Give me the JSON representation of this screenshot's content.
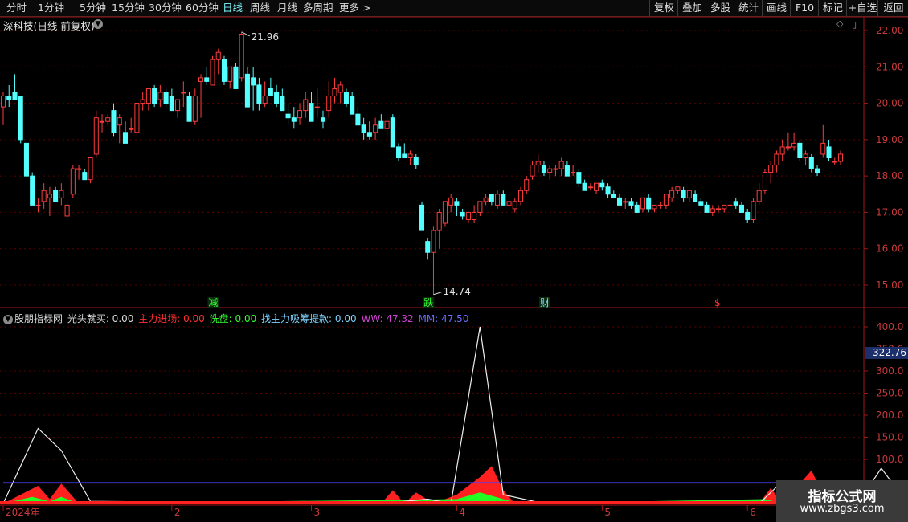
{
  "toolbar": {
    "timeframes": [
      "分时",
      "1分钟",
      "5分钟",
      "15分钟",
      "30分钟",
      "60分钟",
      "日线",
      "周线",
      "月线",
      "多周期",
      "更多 >"
    ],
    "active_timeframe": "日线",
    "right_buttons": [
      "复权",
      "叠加",
      "多股",
      "统计",
      "画线",
      "F10",
      "标记",
      "+自选",
      "返回"
    ]
  },
  "stock_title": "深科技(日线 前复权)",
  "price_axis": {
    "ticks": [
      "22.00",
      "21.00",
      "20.00",
      "19.00",
      "18.00",
      "17.00",
      "16.00",
      "15.00"
    ]
  },
  "price_annotations": {
    "high_label": "21.96",
    "low_label": "14.74"
  },
  "event_markers": [
    {
      "text": "减",
      "color": "#33ff33"
    },
    {
      "text": "跌",
      "color": "#33ff33"
    },
    {
      "text": "财",
      "color": "#7fd4ff"
    },
    {
      "text": "$",
      "color": "#ff3030"
    }
  ],
  "indicator": {
    "name": "股朋指标网",
    "items": [
      {
        "label": "光头就买:",
        "value": "0.00",
        "color": "#d8d8d8"
      },
      {
        "label": "主力进场:",
        "value": "0.00",
        "color": "#ff3030"
      },
      {
        "label": "洗盘:",
        "value": "0.00",
        "color": "#33ff33"
      },
      {
        "label": "找主力吸筹提款:",
        "value": "0.00",
        "color": "#7fd4ff"
      },
      {
        "label": "WW:",
        "value": "47.32",
        "color": "#d040d0"
      },
      {
        "label": "MM:",
        "value": "47.50",
        "color": "#6b6bff"
      }
    ],
    "axis_ticks": [
      "400.0",
      "350.0",
      "300.0",
      "250.0",
      "200.0",
      "150.0",
      "100.0"
    ],
    "current_value": "322.76"
  },
  "date_labels": [
    "2024年",
    "2",
    "3",
    "4",
    "5",
    "6"
  ],
  "watermark": {
    "line1": "指标公式网",
    "line2": "www.zbgs3.com"
  },
  "colors": {
    "up": "#ff3c3c",
    "down": "#54ffff",
    "grid": "#5a0000",
    "panel_border": "#a01818"
  },
  "chart_data": {
    "type": "candlestick",
    "ylim": [
      14.6,
      22.2
    ],
    "candles": [
      [
        19.9,
        20.3,
        19.4,
        20.2
      ],
      [
        20.2,
        20.5,
        19.9,
        20.1
      ],
      [
        20.3,
        20.8,
        20.1,
        20.1
      ],
      [
        20.2,
        20.2,
        18.9,
        19.0
      ],
      [
        18.9,
        18.9,
        18.1,
        18.0
      ],
      [
        18.0,
        18.1,
        17.3,
        17.2
      ],
      [
        17.2,
        17.4,
        17.0,
        17.2
      ],
      [
        17.3,
        17.8,
        17.1,
        17.6
      ],
      [
        17.4,
        17.7,
        16.9,
        17.5
      ],
      [
        17.6,
        17.7,
        17.3,
        17.3
      ],
      [
        17.4,
        17.8,
        17.2,
        17.6
      ],
      [
        16.9,
        17.3,
        16.8,
        17.2
      ],
      [
        17.5,
        18.3,
        17.4,
        18.2
      ],
      [
        18.2,
        18.3,
        17.9,
        18.2
      ],
      [
        18.1,
        18.2,
        17.9,
        17.9
      ],
      [
        17.9,
        18.5,
        17.8,
        18.5
      ],
      [
        18.6,
        19.8,
        18.5,
        19.6
      ],
      [
        19.5,
        19.7,
        19.2,
        19.5
      ],
      [
        19.5,
        19.7,
        19.4,
        19.6
      ],
      [
        19.8,
        20.0,
        19.1,
        19.2
      ],
      [
        19.4,
        19.7,
        18.9,
        19.6
      ],
      [
        19.2,
        19.5,
        18.9,
        18.9
      ],
      [
        19.3,
        19.6,
        19.2,
        19.3
      ],
      [
        19.2,
        20.0,
        19.1,
        20.0
      ],
      [
        20.0,
        20.3,
        19.8,
        20.1
      ],
      [
        20.0,
        20.3,
        19.8,
        20.4
      ],
      [
        20.4,
        20.5,
        19.9,
        20.0
      ],
      [
        20.1,
        20.5,
        19.9,
        20.3
      ],
      [
        20.3,
        20.4,
        19.9,
        20.0
      ],
      [
        20.2,
        20.4,
        19.8,
        19.8
      ],
      [
        19.8,
        20.1,
        19.6,
        20.1
      ],
      [
        20.3,
        20.6,
        19.9,
        20.3
      ],
      [
        20.2,
        20.3,
        19.5,
        19.5
      ],
      [
        19.5,
        20.4,
        19.4,
        20.2
      ],
      [
        20.6,
        20.8,
        19.6,
        20.7
      ],
      [
        20.7,
        21.0,
        20.5,
        20.6
      ],
      [
        20.5,
        21.3,
        20.5,
        21.2
      ],
      [
        21.2,
        21.5,
        20.8,
        21.4
      ],
      [
        21.2,
        21.3,
        20.5,
        20.6
      ],
      [
        20.6,
        21.0,
        20.4,
        21.0
      ],
      [
        21.0,
        21.1,
        20.4,
        20.4
      ],
      [
        20.7,
        21.96,
        20.6,
        21.9
      ],
      [
        20.8,
        21.0,
        19.9,
        19.9
      ],
      [
        20.7,
        21.0,
        19.8,
        20.5
      ],
      [
        20.5,
        20.7,
        19.8,
        20.0
      ],
      [
        20.0,
        20.6,
        19.9,
        20.2
      ],
      [
        20.4,
        20.7,
        20.2,
        20.2
      ],
      [
        20.3,
        20.5,
        19.9,
        20.0
      ],
      [
        20.2,
        20.4,
        19.9,
        19.8
      ],
      [
        19.7,
        20.0,
        19.4,
        19.6
      ],
      [
        19.6,
        19.9,
        19.3,
        19.5
      ],
      [
        19.6,
        20.0,
        19.4,
        19.8
      ],
      [
        19.8,
        20.3,
        19.6,
        20.1
      ],
      [
        20.0,
        20.3,
        19.5,
        19.5
      ],
      [
        19.9,
        20.4,
        19.6,
        19.9
      ],
      [
        19.6,
        19.8,
        19.3,
        19.5
      ],
      [
        19.8,
        20.6,
        19.6,
        20.2
      ],
      [
        20.2,
        20.7,
        20.0,
        20.4
      ],
      [
        20.3,
        20.6,
        20.0,
        20.5
      ],
      [
        20.3,
        20.4,
        19.9,
        20.0
      ],
      [
        20.2,
        20.3,
        19.7,
        19.7
      ],
      [
        19.7,
        19.9,
        19.4,
        19.4
      ],
      [
        19.4,
        19.6,
        19.0,
        19.2
      ],
      [
        19.2,
        19.5,
        19.0,
        19.1
      ],
      [
        19.2,
        19.6,
        19.0,
        19.4
      ],
      [
        19.5,
        19.7,
        19.3,
        19.3
      ],
      [
        19.3,
        19.6,
        19.0,
        19.5
      ],
      [
        19.6,
        19.7,
        18.8,
        18.8
      ],
      [
        18.8,
        18.9,
        18.4,
        18.5
      ],
      [
        18.6,
        18.9,
        18.5,
        18.5
      ],
      [
        18.5,
        18.7,
        18.3,
        18.6
      ],
      [
        18.5,
        18.6,
        18.2,
        18.3
      ],
      [
        17.2,
        17.3,
        16.5,
        16.5
      ],
      [
        16.2,
        16.3,
        15.7,
        15.9
      ],
      [
        15.9,
        16.6,
        14.74,
        16.5
      ],
      [
        16.5,
        17.1,
        16.0,
        17.0
      ],
      [
        16.7,
        17.3,
        16.6,
        17.3
      ],
      [
        17.2,
        17.5,
        17.0,
        17.4
      ],
      [
        17.3,
        17.4,
        16.9,
        17.2
      ],
      [
        17.0,
        17.1,
        16.8,
        16.9
      ],
      [
        16.8,
        17.0,
        16.7,
        17.0
      ],
      [
        16.8,
        17.2,
        16.7,
        17.0
      ],
      [
        17.0,
        17.3,
        16.9,
        17.3
      ],
      [
        17.3,
        17.5,
        17.2,
        17.4
      ],
      [
        17.5,
        17.5,
        17.2,
        17.3
      ],
      [
        17.2,
        17.6,
        17.1,
        17.5
      ],
      [
        17.5,
        17.6,
        17.2,
        17.2
      ],
      [
        17.2,
        17.5,
        17.1,
        17.3
      ],
      [
        17.1,
        17.4,
        17.0,
        17.3
      ],
      [
        17.3,
        17.7,
        17.2,
        17.6
      ],
      [
        17.6,
        18.0,
        17.5,
        17.9
      ],
      [
        18.0,
        18.4,
        17.9,
        18.3
      ],
      [
        18.3,
        18.6,
        18.1,
        18.4
      ],
      [
        18.3,
        18.4,
        18.0,
        18.1
      ],
      [
        18.1,
        18.3,
        17.9,
        18.2
      ],
      [
        18.2,
        18.3,
        18.0,
        18.2
      ],
      [
        18.2,
        18.5,
        18.0,
        18.4
      ],
      [
        18.3,
        18.4,
        18.0,
        18.0
      ],
      [
        18.1,
        18.3,
        18.0,
        18.1
      ],
      [
        18.1,
        18.2,
        17.7,
        17.8
      ],
      [
        17.8,
        17.9,
        17.6,
        17.6
      ],
      [
        17.7,
        17.8,
        17.6,
        17.7
      ],
      [
        17.6,
        17.8,
        17.5,
        17.8
      ],
      [
        17.8,
        17.9,
        17.6,
        17.7
      ],
      [
        17.7,
        17.8,
        17.4,
        17.5
      ],
      [
        17.5,
        17.6,
        17.4,
        17.4
      ],
      [
        17.4,
        17.5,
        17.2,
        17.2
      ],
      [
        17.3,
        17.4,
        17.1,
        17.3
      ],
      [
        17.3,
        17.4,
        17.1,
        17.2
      ],
      [
        17.2,
        17.3,
        17.0,
        17.0
      ],
      [
        17.1,
        17.4,
        17.0,
        17.4
      ],
      [
        17.4,
        17.5,
        17.0,
        17.1
      ],
      [
        17.1,
        17.2,
        17.0,
        17.2
      ],
      [
        17.2,
        17.3,
        17.1,
        17.2
      ],
      [
        17.2,
        17.5,
        17.1,
        17.5
      ],
      [
        17.4,
        17.7,
        17.3,
        17.6
      ],
      [
        17.6,
        17.7,
        17.5,
        17.7
      ],
      [
        17.6,
        17.7,
        17.3,
        17.4
      ],
      [
        17.4,
        17.6,
        17.3,
        17.6
      ],
      [
        17.5,
        17.6,
        17.3,
        17.3
      ],
      [
        17.3,
        17.4,
        17.2,
        17.2
      ],
      [
        17.2,
        17.3,
        17.0,
        17.0
      ],
      [
        17.0,
        17.2,
        16.9,
        17.1
      ],
      [
        17.1,
        17.2,
        17.0,
        17.1
      ],
      [
        17.1,
        17.2,
        17.0,
        17.2
      ],
      [
        17.2,
        17.3,
        17.0,
        17.2
      ],
      [
        17.3,
        17.4,
        17.1,
        17.2
      ],
      [
        17.2,
        17.3,
        17.0,
        17.0
      ],
      [
        17.0,
        17.1,
        16.7,
        16.8
      ],
      [
        16.8,
        17.4,
        16.7,
        17.3
      ],
      [
        17.3,
        17.8,
        17.2,
        17.6
      ],
      [
        17.6,
        18.2,
        17.5,
        18.1
      ],
      [
        18.1,
        18.4,
        17.8,
        18.3
      ],
      [
        18.3,
        18.7,
        18.1,
        18.6
      ],
      [
        18.6,
        19.0,
        18.4,
        18.8
      ],
      [
        18.8,
        19.2,
        18.7,
        18.8
      ],
      [
        18.8,
        19.2,
        18.7,
        18.9
      ],
      [
        18.9,
        19.0,
        18.4,
        18.5
      ],
      [
        18.5,
        18.7,
        18.3,
        18.6
      ],
      [
        18.5,
        18.6,
        18.1,
        18.2
      ],
      [
        18.2,
        18.3,
        18.0,
        18.1
      ],
      [
        18.6,
        19.4,
        18.5,
        18.9
      ],
      [
        18.8,
        19.0,
        18.4,
        18.5
      ],
      [
        18.4,
        18.5,
        18.3,
        18.4
      ],
      [
        18.4,
        18.7,
        18.3,
        18.6
      ]
    ],
    "indicator_white": [
      [
        0,
        0
      ],
      [
        6,
        170
      ],
      [
        10,
        120
      ],
      [
        15,
        5
      ],
      [
        65,
        0
      ],
      [
        73,
        10
      ],
      [
        77,
        0
      ],
      [
        82,
        400
      ],
      [
        86,
        20
      ],
      [
        93,
        0
      ],
      [
        130,
        0
      ],
      [
        134,
        50
      ],
      [
        138,
        5
      ],
      [
        147,
        0
      ],
      [
        151,
        80
      ],
      [
        155,
        10
      ],
      [
        160,
        0
      ]
    ],
    "indicator_red": [
      [
        0,
        0
      ],
      [
        6,
        40
      ],
      [
        8,
        10
      ],
      [
        10,
        45
      ],
      [
        13,
        0
      ],
      [
        65,
        0
      ],
      [
        67,
        30
      ],
      [
        69,
        0
      ],
      [
        71,
        25
      ],
      [
        74,
        0
      ],
      [
        78,
        20
      ],
      [
        82,
        60
      ],
      [
        84,
        85
      ],
      [
        86,
        30
      ],
      [
        88,
        0
      ],
      [
        130,
        0
      ],
      [
        132,
        35
      ],
      [
        134,
        0
      ],
      [
        136,
        30
      ],
      [
        139,
        75
      ],
      [
        141,
        20
      ],
      [
        143,
        0
      ]
    ],
    "indicator_green": [
      [
        0,
        0
      ],
      [
        5,
        15
      ],
      [
        8,
        5
      ],
      [
        10,
        15
      ],
      [
        13,
        0
      ],
      [
        78,
        10
      ],
      [
        82,
        25
      ],
      [
        86,
        10
      ],
      [
        89,
        0
      ],
      [
        131,
        10
      ],
      [
        134,
        0
      ],
      [
        137,
        20
      ],
      [
        140,
        10
      ],
      [
        142,
        0
      ]
    ],
    "ww_level": 47.32,
    "mm_level": 47.5,
    "indicator_ylim": [
      0,
      430
    ]
  }
}
